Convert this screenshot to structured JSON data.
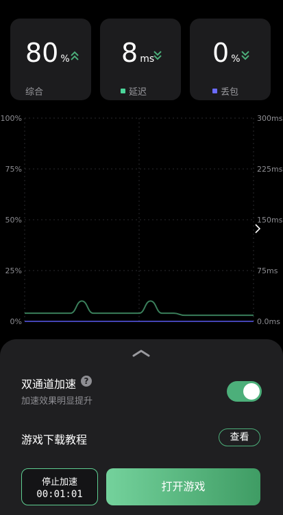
{
  "stats": {
    "overall": {
      "value": "80",
      "unit": "%",
      "label": "综合",
      "trend_icon": "chevron-double-up-icon",
      "color": "#4caf7a"
    },
    "latency": {
      "value": "8",
      "unit": "ms",
      "label": "延迟",
      "legend_color": "#4bd59a",
      "trend_icon": "chevron-double-down-icon",
      "color": "#4caf7a"
    },
    "packet_loss": {
      "value": "0",
      "unit": "%",
      "label": "丢包",
      "legend_color": "#6b6bff",
      "trend_icon": "chevron-double-down-icon",
      "color": "#4caf7a"
    }
  },
  "chart_data": {
    "type": "line",
    "left_axis_ticks": [
      "100%",
      "75%",
      "50%",
      "25%",
      "0%"
    ],
    "right_axis_ticks": [
      "300ms",
      "225ms",
      "150ms",
      "75ms",
      "0.0ms"
    ],
    "ylim": [
      0,
      100
    ],
    "y2lim": [
      0,
      300
    ],
    "grid": true,
    "x": [
      0,
      5,
      10,
      15,
      20,
      25,
      30,
      35,
      40,
      45,
      50,
      55,
      60,
      65,
      70,
      75,
      80,
      85,
      90,
      95,
      100
    ],
    "series": [
      {
        "color": "#3a7f5b",
        "axis": "left",
        "values": [
          4,
          4,
          4,
          4,
          4,
          10,
          4,
          4,
          4,
          4,
          4,
          10,
          4,
          4,
          3,
          3,
          3,
          3,
          3,
          3,
          3
        ]
      },
      {
        "color": "#5a5af0",
        "axis": "left",
        "values": [
          0,
          0,
          0,
          0,
          0,
          0,
          0,
          0,
          0,
          0,
          0,
          0,
          0,
          0,
          0,
          0,
          0,
          0,
          0,
          0,
          0
        ]
      }
    ],
    "next_icon": "chevron-right-icon"
  },
  "panel": {
    "collapse_icon": "chevron-up-icon",
    "dual_channel": {
      "title": "双通道加速",
      "subtitle": "加速效果明显提升",
      "help_icon": "help-circle-icon",
      "help_glyph": "?",
      "enabled": true,
      "accent": "#4caf7a"
    },
    "tutorial": {
      "label": "游戏下载教程",
      "button": "查看"
    },
    "stop": {
      "label": "停止加速",
      "timer": "00:01:01"
    },
    "open": {
      "label": "打开游戏"
    }
  }
}
